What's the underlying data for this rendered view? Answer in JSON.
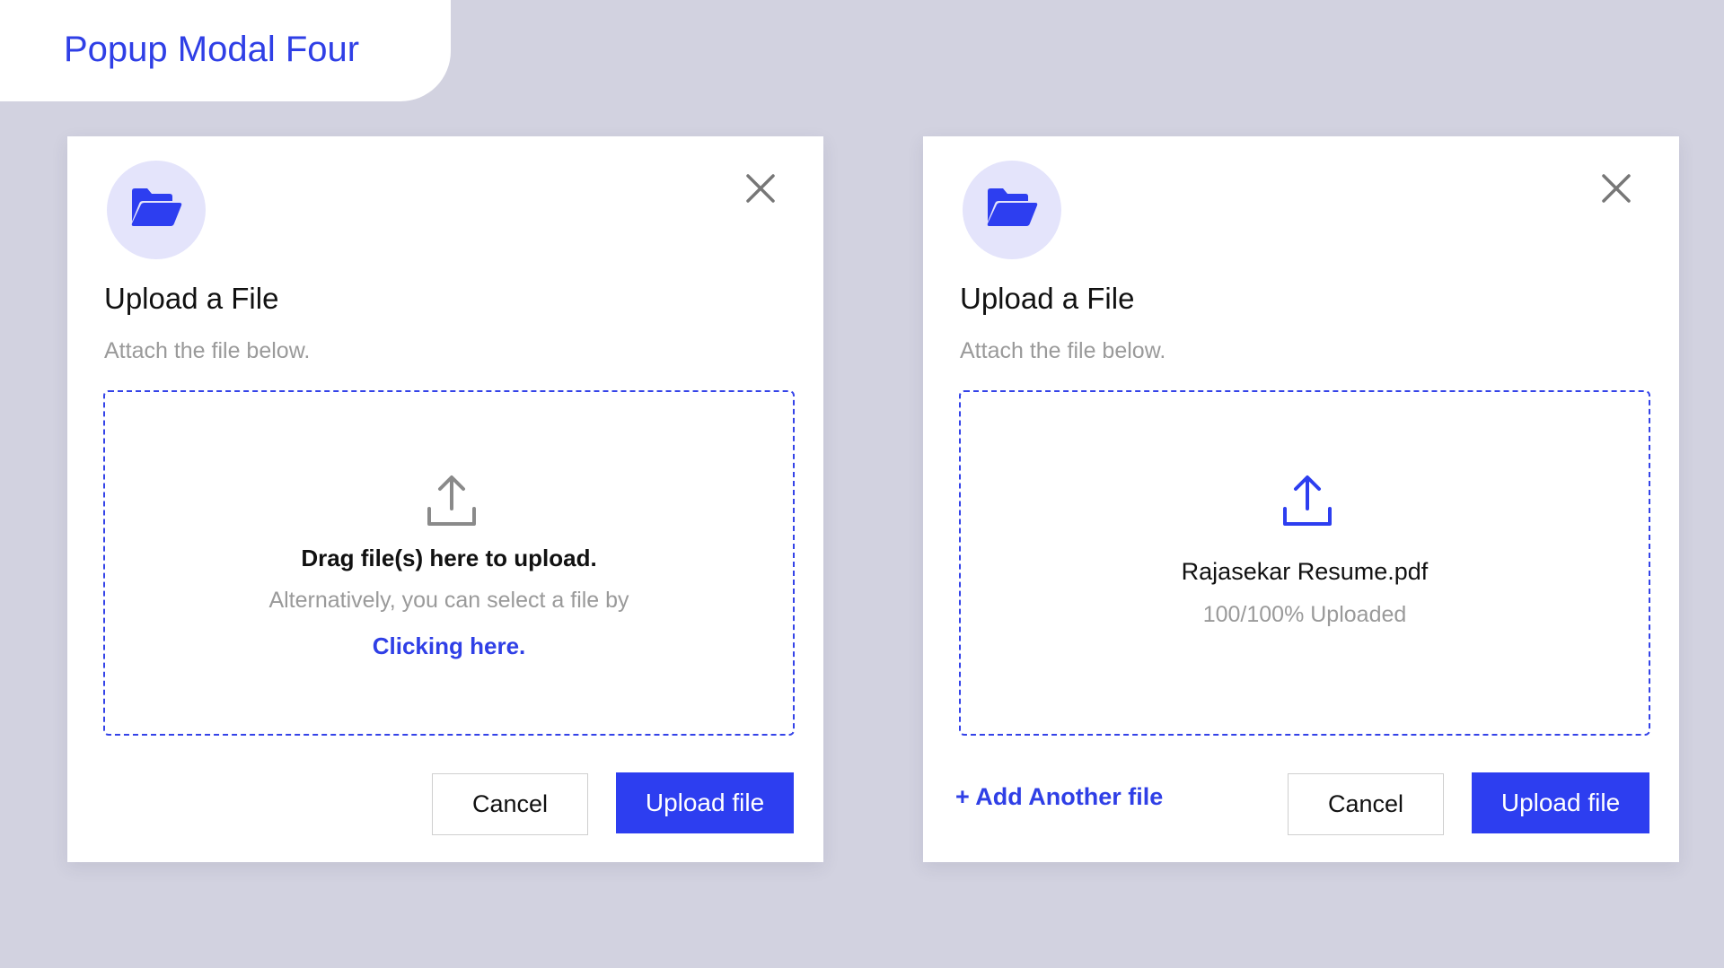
{
  "page": {
    "title": "Popup Modal Four"
  },
  "modals": [
    {
      "title": "Upload a File",
      "subtitle": "Attach the file below.",
      "dropzone": {
        "main_text": "Drag file(s) here to upload.",
        "alt_text": "Alternatively, you can select a file by",
        "link_text": "Clicking here."
      },
      "cancel_label": "Cancel",
      "upload_label": "Upload file"
    },
    {
      "title": "Upload a File",
      "subtitle": "Attach the file below.",
      "dropzone": {
        "file_name": "Rajasekar Resume.pdf",
        "status": "100/100% Uploaded"
      },
      "add_another_label": "+ Add Another file",
      "cancel_label": "Cancel",
      "upload_label": "Upload file"
    }
  ],
  "icons": {
    "folder": "folder-open-icon",
    "close": "close-icon",
    "upload": "upload-icon"
  },
  "colors": {
    "background": "#d2d2e0",
    "accent": "#2d3ef0",
    "folder_circle": "#e4e4fb",
    "muted_text": "#9a9a9a",
    "upload_icon_idle": "#8a8a8a",
    "upload_icon_active": "#2d3ef0"
  }
}
